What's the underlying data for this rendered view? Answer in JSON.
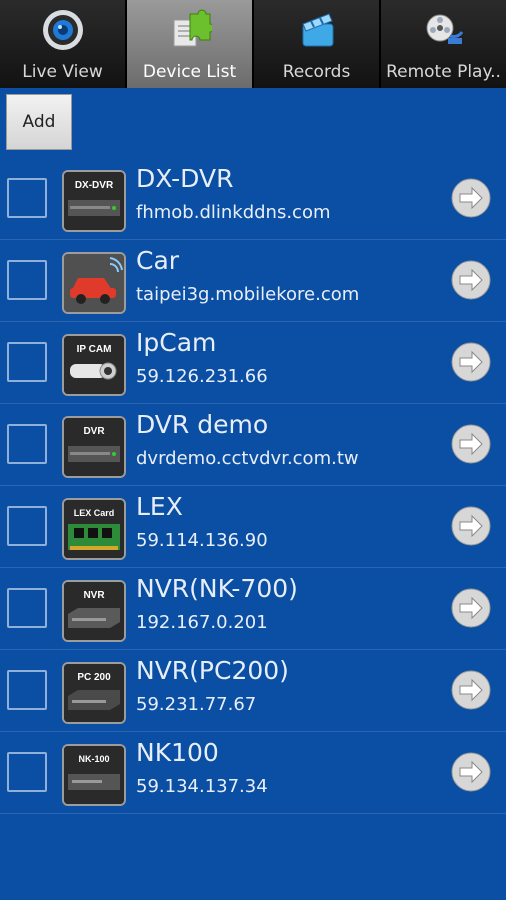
{
  "tabs": [
    {
      "label": "Live View",
      "icon": "camera-lens-icon",
      "active": false
    },
    {
      "label": "Device List",
      "icon": "puzzle-icon",
      "active": true
    },
    {
      "label": "Records",
      "icon": "clapperboard-icon",
      "active": false
    },
    {
      "label": "Remote Play..",
      "icon": "film-reel-icon",
      "active": false
    }
  ],
  "toolbar": {
    "add_label": "Add"
  },
  "devices": [
    {
      "name": "DX-DVR",
      "address": "fhmob.dlinkddns.com",
      "thumb_label": "DX-DVR",
      "icon": "dvr-icon"
    },
    {
      "name": "Car",
      "address": "taipei3g.mobilekore.com",
      "thumb_label": "",
      "icon": "car-icon"
    },
    {
      "name": "IpCam",
      "address": "59.126.231.66",
      "thumb_label": "IP CAM",
      "icon": "ip-camera-icon"
    },
    {
      "name": "DVR demo",
      "address": "dvrdemo.cctvdvr.com.tw",
      "thumb_label": "DVR",
      "icon": "dvr-icon"
    },
    {
      "name": "LEX",
      "address": "59.114.136.90",
      "thumb_label": "LEX Card",
      "icon": "capture-card-icon"
    },
    {
      "name": "NVR(NK-700)",
      "address": "192.167.0.201",
      "thumb_label": "NVR",
      "icon": "nvr-icon"
    },
    {
      "name": "NVR(PC200)",
      "address": "59.231.77.67",
      "thumb_label": "PC 200",
      "icon": "nvr-icon"
    },
    {
      "name": "NK100",
      "address": "59.134.137.34",
      "thumb_label": "NK-100",
      "icon": "nvr-icon"
    }
  ],
  "colors": {
    "background": "#0a4fa3",
    "tab_active": "#8a8a8a",
    "tab_inactive": "#1f1f1f"
  }
}
